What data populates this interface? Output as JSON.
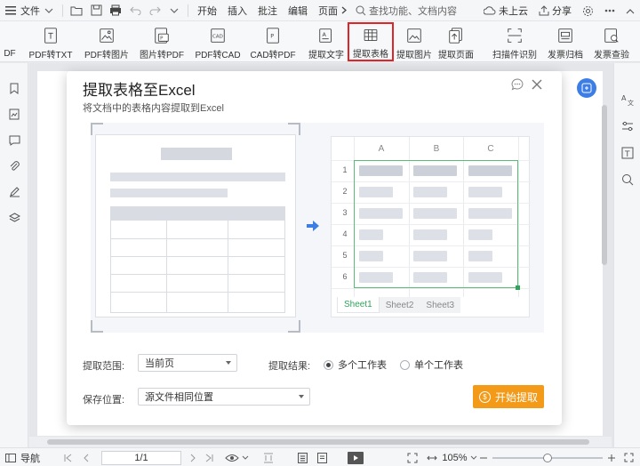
{
  "menubar": {
    "file_label": "文件",
    "tabs": [
      "开始",
      "插入",
      "批注",
      "编辑",
      "页面"
    ],
    "search_placeholder": "查找功能、文档内容",
    "cloud_label": "未上云",
    "share_label": "分享"
  },
  "ribbon": {
    "items": [
      {
        "label": "DF"
      },
      {
        "label": "PDF转TXT"
      },
      {
        "label": "PDF转图片"
      },
      {
        "label": "图片转PDF"
      },
      {
        "label": "PDF转CAD"
      },
      {
        "label": "CAD转PDF"
      },
      {
        "label": "提取文字"
      },
      {
        "label": "提取表格"
      },
      {
        "label": "提取图片"
      },
      {
        "label": "提取页面"
      },
      {
        "label": "扫描件识别"
      },
      {
        "label": "发票归档"
      },
      {
        "label": "发票查验"
      }
    ]
  },
  "dialog": {
    "title": "提取表格至Excel",
    "subtitle": "将文档中的表格内容提取到Excel",
    "sheet": {
      "columns": [
        "A",
        "B",
        "C"
      ],
      "rows": [
        "1",
        "2",
        "3",
        "4",
        "5",
        "6"
      ],
      "tabs": [
        "Sheet1",
        "Sheet2",
        "Sheet3"
      ]
    },
    "range_label": "提取范围:",
    "range_value": "当前页",
    "result_label": "提取结果:",
    "result_options": [
      "多个工作表",
      "单个工作表"
    ],
    "save_label": "保存位置:",
    "save_value": "源文件相同位置",
    "start_button": "开始提取"
  },
  "status": {
    "nav_label": "导航",
    "page_indicator": "1/1",
    "zoom": "105%"
  },
  "colors": {
    "accent_blue": "#3d7ee6",
    "start_orange": "#f39a18",
    "excel_green": "#2fa35a",
    "highlight_red": "#e0242a"
  }
}
